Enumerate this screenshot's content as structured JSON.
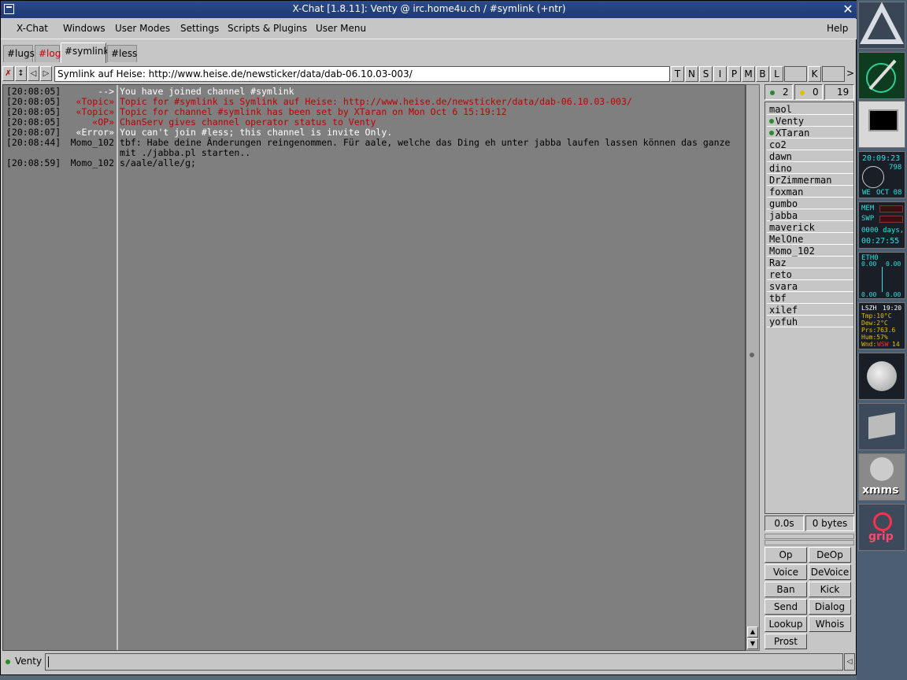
{
  "window": {
    "title": "X-Chat [1.8.11]: Venty @ irc.home4u.ch / #symlink (+ntr)"
  },
  "menu": {
    "xchat": "X-Chat",
    "windows": "Windows",
    "user_modes": "User Modes",
    "settings": "Settings",
    "scripts": "Scripts & Plugins",
    "user_menu": "User Menu",
    "help": "Help"
  },
  "tabs": [
    {
      "label": "#lugs",
      "color": "#000000"
    },
    {
      "label": "#log",
      "color": "#cc0000"
    },
    {
      "label": "#symlink",
      "color": "#000000",
      "active": true
    },
    {
      "label": "#less",
      "color": "#000000"
    }
  ],
  "topic": {
    "text": "Symlink auf Heise: http://www.heise.de/newsticker/data/dab-06.10.03-003/"
  },
  "modes": {
    "t": "T",
    "n": "N",
    "s": "S",
    "i": "I",
    "p": "P",
    "m": "M",
    "b": "B",
    "l": "L",
    "k": "K",
    "more": ">"
  },
  "chat": [
    {
      "time": "[20:08:05]",
      "nick": "-->",
      "text": " You have joined channel #symlink",
      "color": "#ffffff"
    },
    {
      "time": "[20:08:05]",
      "nick": "«Topic»",
      "text": "Topic for #symlink is Symlink auf Heise: http://www.heise.de/newsticker/data/dab-06.10.03-003/",
      "color": "#c00000"
    },
    {
      "time": "[20:08:05]",
      "nick": "«Topic»",
      "text": "Topic for channel #symlink has been set by XTaran on Mon Oct  6 15:19:12",
      "color": "#c00000"
    },
    {
      "time": "[20:08:05]",
      "nick": "«OP»",
      "text": "ChanServ gives channel operator status to Venty",
      "color": "#c00000"
    },
    {
      "time": "[20:08:07]",
      "nick": "«Error»",
      "text": "You can't join #less; this channel is invite Only.",
      "color": "#ffffff"
    },
    {
      "time": "[20:08:44]",
      "nick": "Momo_102",
      "text": "tbf: Habe deine Änderungen reingenommen. Für aale, welche das Ding eh unter jabba laufen lassen können das ganze",
      "color": "#000000"
    },
    {
      "time": "",
      "nick": "",
      "text": "mit ./jabba.pl starten..",
      "color": "#000000"
    },
    {
      "time": "[20:08:59]",
      "nick": "Momo_102",
      "text": "s/aale/alle/g;",
      "color": "#000000"
    }
  ],
  "counts": {
    "ops": "2",
    "voices": "0",
    "total": "19"
  },
  "users": [
    {
      "name": "maol",
      "op": false
    },
    {
      "name": "Venty",
      "op": true
    },
    {
      "name": "XTaran",
      "op": true
    },
    {
      "name": "co2",
      "op": false
    },
    {
      "name": "dawn",
      "op": false
    },
    {
      "name": "dino",
      "op": false
    },
    {
      "name": "DrZimmerman",
      "op": false
    },
    {
      "name": "foxman",
      "op": false
    },
    {
      "name": "gumbo",
      "op": false
    },
    {
      "name": "jabba",
      "op": false
    },
    {
      "name": "maverick",
      "op": false
    },
    {
      "name": "MelOne",
      "op": false
    },
    {
      "name": "Momo_102",
      "op": false
    },
    {
      "name": "Raz",
      "op": false
    },
    {
      "name": "reto",
      "op": false
    },
    {
      "name": "svara",
      "op": false
    },
    {
      "name": "tbf",
      "op": false
    },
    {
      "name": "xilef",
      "op": false
    },
    {
      "name": "yofuh",
      "op": false
    }
  ],
  "lag": {
    "time": "0.0s",
    "bytes": "0 bytes"
  },
  "buttons": {
    "op": "Op",
    "deop": "DeOp",
    "voice": "Voice",
    "devoice": "DeVoice",
    "ban": "Ban",
    "kick": "Kick",
    "send": "Send",
    "dialog": "Dialog",
    "lookup": "Lookup",
    "whois": "Whois",
    "prost": "Prost"
  },
  "input": {
    "nick": "Venty",
    "value": ""
  },
  "dock": {
    "clock_time": "20:09:23",
    "clock_num": "798",
    "clock_day": "WE",
    "clock_date": "OCT 08",
    "mem": "MEM",
    "swp": "SWP",
    "uptime_days": "0000 days,",
    "uptime": "00:27:55",
    "net_iface": "ETH0",
    "net_in": "0.00",
    "net_out": "0.00",
    "net_in2": "0.00",
    "net_out2": "0.00",
    "wx_station": "LSZH",
    "wx_time": "19:20",
    "wx_tmp": "Tmp:10°C",
    "wx_dew": "Dew:2°C",
    "wx_prs": "Prs:763.6",
    "wx_hum": "Hum:57%",
    "wx_wnd": "Wnd:",
    "wx_wnd_dir": "WSW",
    "wx_wnd_val": "14",
    "xmms": "xmms",
    "grip": "grip"
  }
}
